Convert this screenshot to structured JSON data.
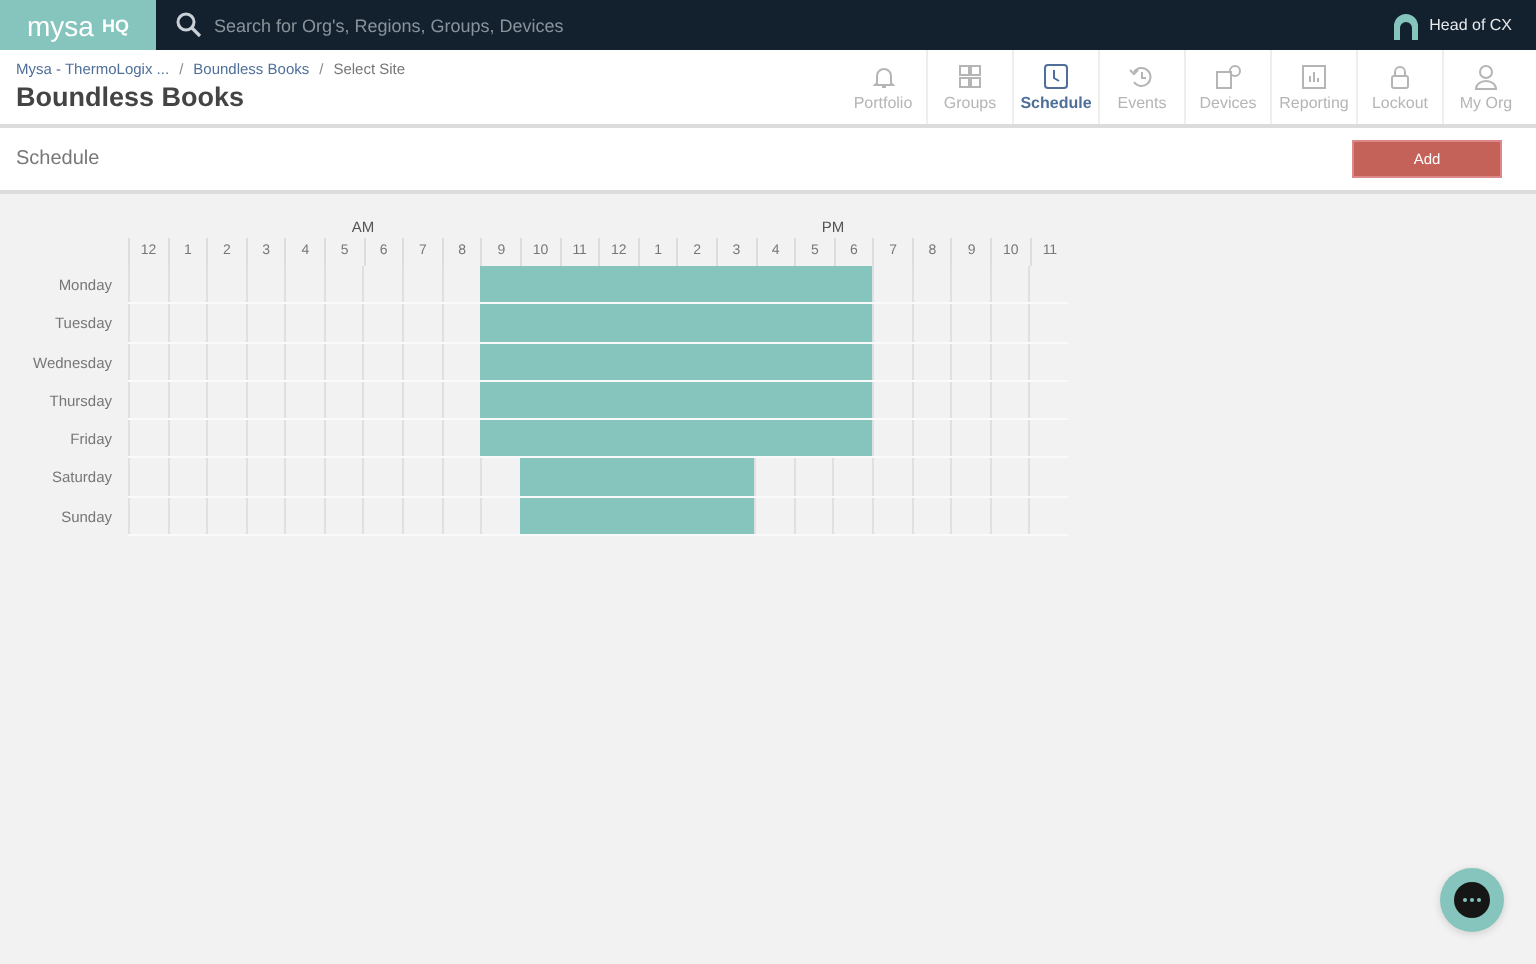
{
  "topbar": {
    "logo": "mysa",
    "logo_suffix": "HQ",
    "search": {
      "placeholder": "Search for Org's, Regions, Groups, Devices"
    },
    "user": "Head of CX"
  },
  "breadcrumbs": [
    "Mysa - ThermoLogix ...",
    "Boundless Books",
    "Select Site"
  ],
  "breadcrumb_separator": "/",
  "page_title": "Boundless Books",
  "nav": [
    {
      "label": "Portfolio",
      "kind": "bell",
      "selected": false
    },
    {
      "label": "Groups",
      "kind": "grid",
      "selected": false
    },
    {
      "label": "Schedule",
      "kind": "clock",
      "selected": true
    },
    {
      "label": "Events",
      "kind": "history",
      "selected": false
    },
    {
      "label": "Devices",
      "kind": "devices",
      "selected": false
    },
    {
      "label": "Reporting",
      "kind": "chart",
      "selected": false
    },
    {
      "label": "Lockout",
      "kind": "lock",
      "selected": false
    },
    {
      "label": "My Org",
      "kind": "person",
      "selected": false
    }
  ],
  "section": {
    "title": "Schedule",
    "button": "Add"
  },
  "schedule": {
    "periods": [
      "AM",
      "PM"
    ],
    "hours": [
      "12",
      "1",
      "2",
      "3",
      "4",
      "5",
      "6",
      "7",
      "8",
      "9",
      "10",
      "11",
      "12",
      "1",
      "2",
      "3",
      "4",
      "5",
      "6",
      "7",
      "8",
      "9",
      "10",
      "11"
    ],
    "days": [
      {
        "name": "Monday",
        "on": [
          false,
          false,
          false,
          false,
          false,
          false,
          false,
          false,
          false,
          true,
          true,
          true,
          true,
          true,
          true,
          true,
          true,
          true,
          true,
          false,
          false,
          false,
          false,
          false
        ]
      },
      {
        "name": "Tuesday",
        "on": [
          false,
          false,
          false,
          false,
          false,
          false,
          false,
          false,
          false,
          true,
          true,
          true,
          true,
          true,
          true,
          true,
          true,
          true,
          true,
          false,
          false,
          false,
          false,
          false
        ]
      },
      {
        "name": "Wednesday",
        "on": [
          false,
          false,
          false,
          false,
          false,
          false,
          false,
          false,
          false,
          true,
          true,
          true,
          true,
          true,
          true,
          true,
          true,
          true,
          true,
          false,
          false,
          false,
          false,
          false
        ]
      },
      {
        "name": "Thursday",
        "on": [
          false,
          false,
          false,
          false,
          false,
          false,
          false,
          false,
          false,
          true,
          true,
          true,
          true,
          true,
          true,
          true,
          true,
          true,
          true,
          false,
          false,
          false,
          false,
          false
        ]
      },
      {
        "name": "Friday",
        "on": [
          false,
          false,
          false,
          false,
          false,
          false,
          false,
          false,
          false,
          true,
          true,
          true,
          true,
          true,
          true,
          true,
          true,
          true,
          true,
          false,
          false,
          false,
          false,
          false
        ]
      },
      {
        "name": "Saturday",
        "on": [
          false,
          false,
          false,
          false,
          false,
          false,
          false,
          false,
          false,
          false,
          true,
          true,
          true,
          true,
          true,
          true,
          false,
          false,
          false,
          false,
          false,
          false,
          false,
          false
        ]
      },
      {
        "name": "Sunday",
        "on": [
          false,
          false,
          false,
          false,
          false,
          false,
          false,
          false,
          false,
          false,
          true,
          true,
          true,
          true,
          true,
          true,
          false,
          false,
          false,
          false,
          false,
          false,
          false,
          false
        ]
      }
    ]
  }
}
